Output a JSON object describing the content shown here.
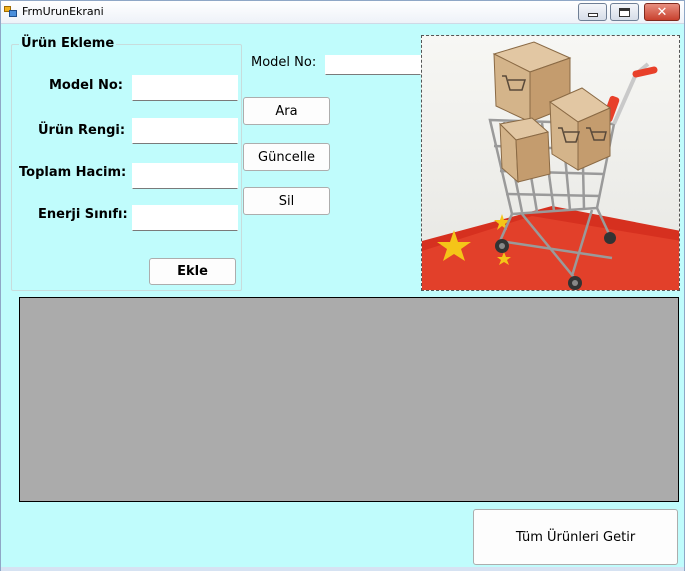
{
  "window": {
    "title": "FrmUrunEkrani"
  },
  "group": {
    "title": "Ürün Ekleme",
    "fields": [
      {
        "label": "Model No:",
        "value": ""
      },
      {
        "label": "Ürün Rengi:",
        "value": ""
      },
      {
        "label": "Toplam Hacim:",
        "value": ""
      },
      {
        "label": "Enerji Sınıfı:",
        "value": ""
      }
    ],
    "add_button": "Ekle"
  },
  "search": {
    "label": "Model No:",
    "value": ""
  },
  "actions": {
    "search_button": "Ara",
    "update_button": "Güncelle",
    "delete_button": "Sil"
  },
  "footer": {
    "get_all_button": "Tüm Ürünleri Getir"
  },
  "colors": {
    "form_background": "#c0fcfc",
    "grid_background": "#ababab"
  }
}
